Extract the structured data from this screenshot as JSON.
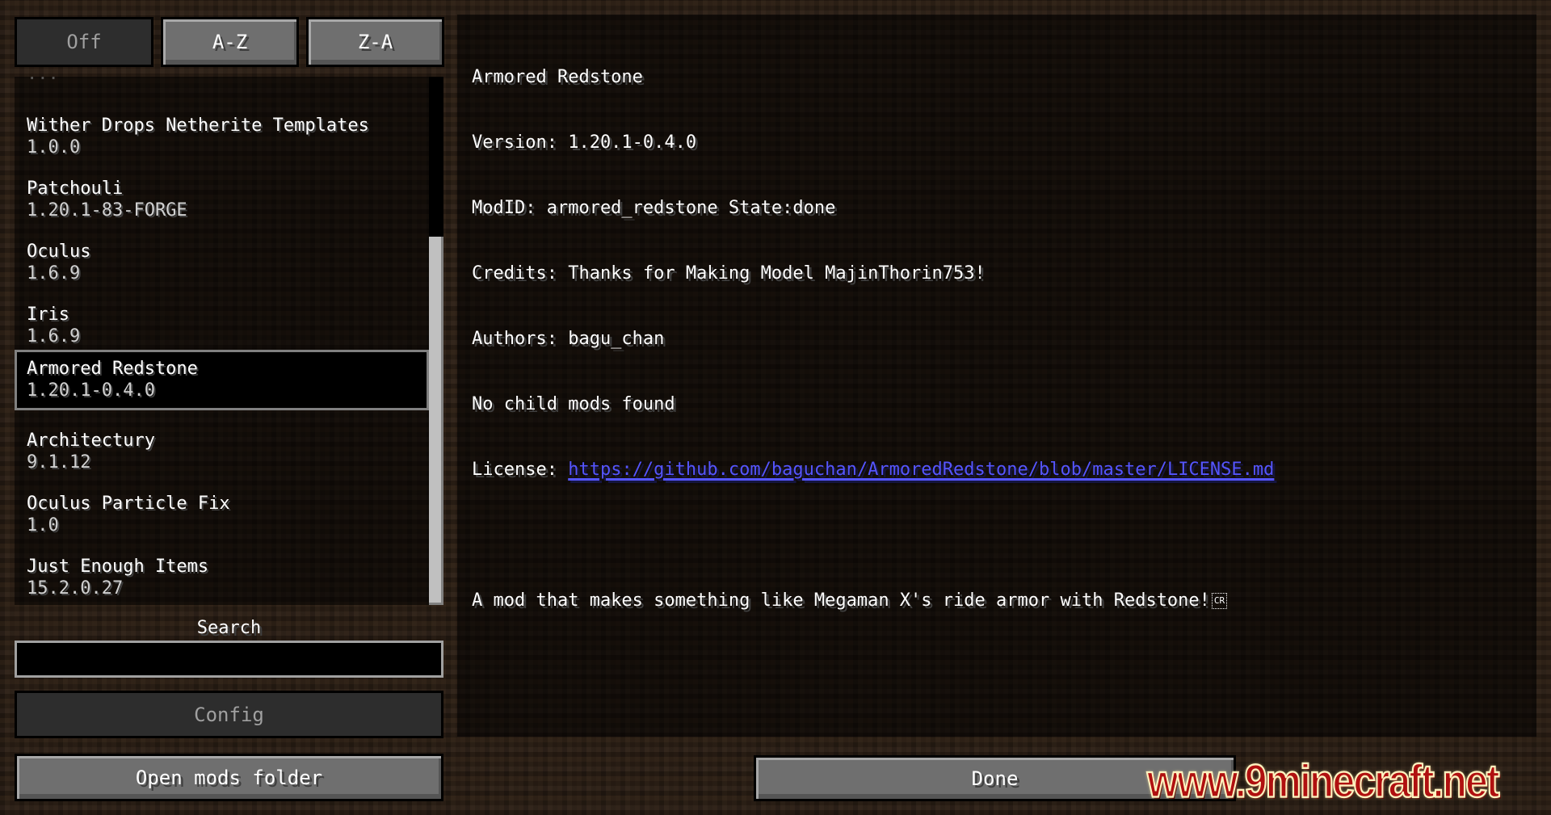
{
  "sort_buttons": [
    {
      "label": "Off",
      "disabled": true
    },
    {
      "label": "A-Z",
      "disabled": false
    },
    {
      "label": "Z-A",
      "disabled": false
    }
  ],
  "mod_list": {
    "partial_item_above": "...",
    "items": [
      {
        "name": "Wither Drops Netherite Templates",
        "version": "1.0.0",
        "selected": false
      },
      {
        "name": "Patchouli",
        "version": "1.20.1-83-FORGE",
        "selected": false
      },
      {
        "name": "Oculus",
        "version": "1.6.9",
        "selected": false
      },
      {
        "name": "Iris",
        "version": "1.6.9",
        "selected": false
      },
      {
        "name": "Armored Redstone",
        "version": "1.20.1-0.4.0",
        "selected": true
      },
      {
        "name": "Architectury",
        "version": "9.1.12",
        "selected": false
      },
      {
        "name": "Oculus Particle Fix",
        "version": "1.0",
        "selected": false
      },
      {
        "name": "Just Enough Items",
        "version": "15.2.0.27",
        "selected": false
      }
    ]
  },
  "search": {
    "label": "Search",
    "value": "",
    "placeholder": ""
  },
  "buttons": {
    "config": "Config",
    "open_mods_folder": "Open mods folder",
    "done": "Done"
  },
  "mod_info": {
    "name": "Armored Redstone",
    "version_line": "Version: 1.20.1-0.4.0",
    "modid_line": "ModID: armored_redstone State:done",
    "credits_line": "Credits: Thanks for Making Model MajinThorin753!",
    "authors_line": "Authors: bagu_chan",
    "children_line": "No child mods found",
    "license_label": "License: ",
    "license_url": "https://github.com/baguchan/ArmoredRedstone/blob/master/LICENSE.md",
    "description": "A mod that makes something like Megaman X's ride armor with Redstone!",
    "cr_glyph": "CR"
  },
  "colors": {
    "link": "#5555ff",
    "text": "#ffffff",
    "disabled_text": "#a0a0a0"
  },
  "watermark": "www.9minecraft.net"
}
